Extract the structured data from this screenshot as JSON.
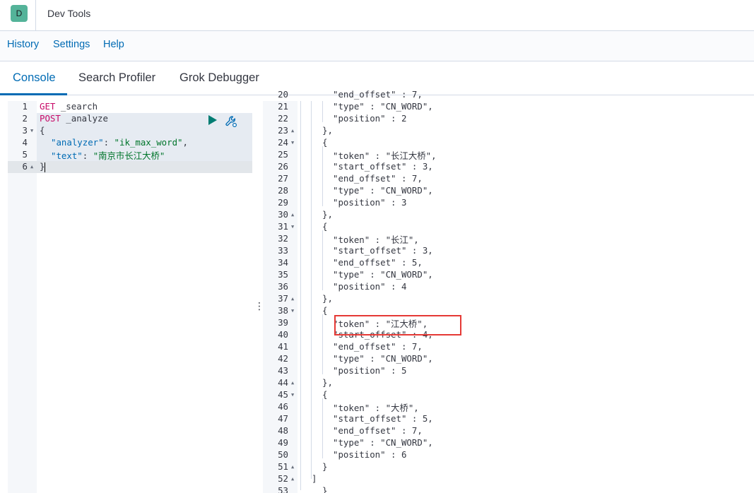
{
  "header": {
    "logo_letter": "D",
    "app_title": "Dev Tools"
  },
  "top_menu": {
    "items": [
      "History",
      "Settings",
      "Help"
    ]
  },
  "tabs": [
    "Console",
    "Search Profiler",
    "Grok Debugger"
  ],
  "active_tab": "Console",
  "request_editor": {
    "line_numbers": [
      "1",
      "2",
      "3",
      "4",
      "5",
      "6"
    ],
    "lines": [
      {
        "method": "GET",
        "path": " _search"
      },
      {
        "method": "POST",
        "path": " _analyze"
      },
      {
        "text": "{"
      },
      {
        "key": "\"analyzer\"",
        "sep": ": ",
        "value": "\"ik_max_word\"",
        "end": ","
      },
      {
        "key": "\"text\"",
        "sep": ": ",
        "value": "\"南京市长江大桥\"",
        "end": ""
      },
      {
        "text": "}"
      }
    ],
    "icons": [
      "play-icon",
      "wrench-icon"
    ]
  },
  "response_viewer": {
    "line_numbers": [
      "20",
      "21",
      "22",
      "23",
      "24",
      "25",
      "26",
      "27",
      "28",
      "29",
      "30",
      "31",
      "32",
      "33",
      "34",
      "35",
      "36",
      "37",
      "38",
      "39",
      "40",
      "41",
      "42",
      "43",
      "44",
      "45",
      "46",
      "47",
      "48",
      "49",
      "50",
      "51",
      "52",
      "53"
    ],
    "lines": [
      "\"end_offset\" : 7,",
      "\"type\" : \"CN_WORD\",",
      "\"position\" : 2",
      "},",
      "{",
      "\"token\" : \"长江大桥\",",
      "\"start_offset\" : 3,",
      "\"end_offset\" : 7,",
      "\"type\" : \"CN_WORD\",",
      "\"position\" : 3",
      "},",
      "{",
      "\"token\" : \"长江\",",
      "\"start_offset\" : 3,",
      "\"end_offset\" : 5,",
      "\"type\" : \"CN_WORD\",",
      "\"position\" : 4",
      "},",
      "{",
      "\"token\" : \"江大桥\",",
      "\"start_offset\" : 4,",
      "\"end_offset\" : 7,",
      "\"type\" : \"CN_WORD\",",
      "\"position\" : 5",
      "},",
      "{",
      "\"token\" : \"大桥\",",
      "\"start_offset\" : 5,",
      "\"end_offset\" : 7,",
      "\"type\" : \"CN_WORD\",",
      "\"position\" : 6",
      "}",
      "]",
      "}"
    ]
  },
  "colors": {
    "accent": "#006bb4",
    "logo_bg": "#54b399",
    "keyword": "#c80a68",
    "string": "#00752b",
    "run_button": "#017d73",
    "highlight_box": "#e53935"
  }
}
